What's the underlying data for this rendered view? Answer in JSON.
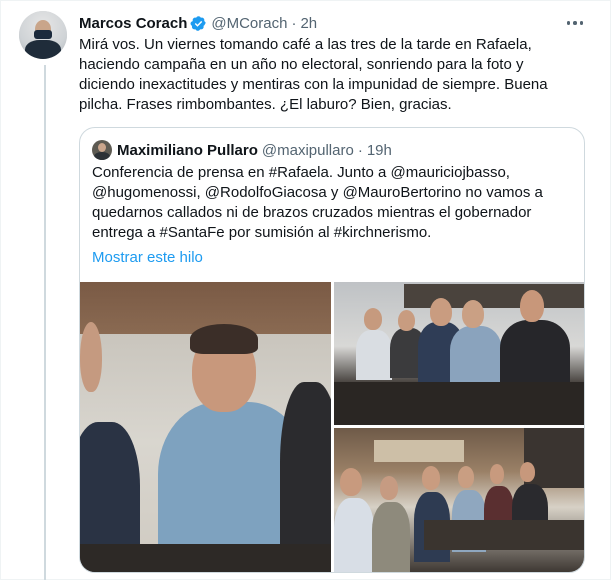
{
  "tweet": {
    "author_name": "Marcos Corach",
    "handle": "@MCorach",
    "separator": "·",
    "time": "2h",
    "verified": true,
    "text": "Mirá vos. Un viernes tomando café a las tres de la tarde en Rafaela, haciendo campaña en un año no electoral, sonriendo para la foto y diciendo inexactitudes y mentiras con la impunidad de siempre. Buena pilcha. Frases rimbombantes. ¿El laburo? Bien, gracias."
  },
  "quote": {
    "author_name": "Maximiliano Pullaro",
    "handle": "@maxipullaro",
    "separator": "·",
    "time": "19h",
    "text": "Conferencia de prensa en #Rafaela. Junto a @mauriciojbasso, @hugomenossi, @RodolfoGiacosa y @MauroBertorino no vamos a quedarnos callados ni de brazos cruzados mientras el gobernador entrega a #SantaFe por sumisión al #kirchnerismo.",
    "show_thread_label": "Mostrar este hilo"
  },
  "icons": {
    "verified": "verified-badge-icon",
    "more": "more-options-icon"
  },
  "colors": {
    "link": "#1d9bf0",
    "secondary_text": "#536471",
    "primary_text": "#0f1419",
    "border": "#cfd9de",
    "thread_line": "#cfd9de"
  }
}
